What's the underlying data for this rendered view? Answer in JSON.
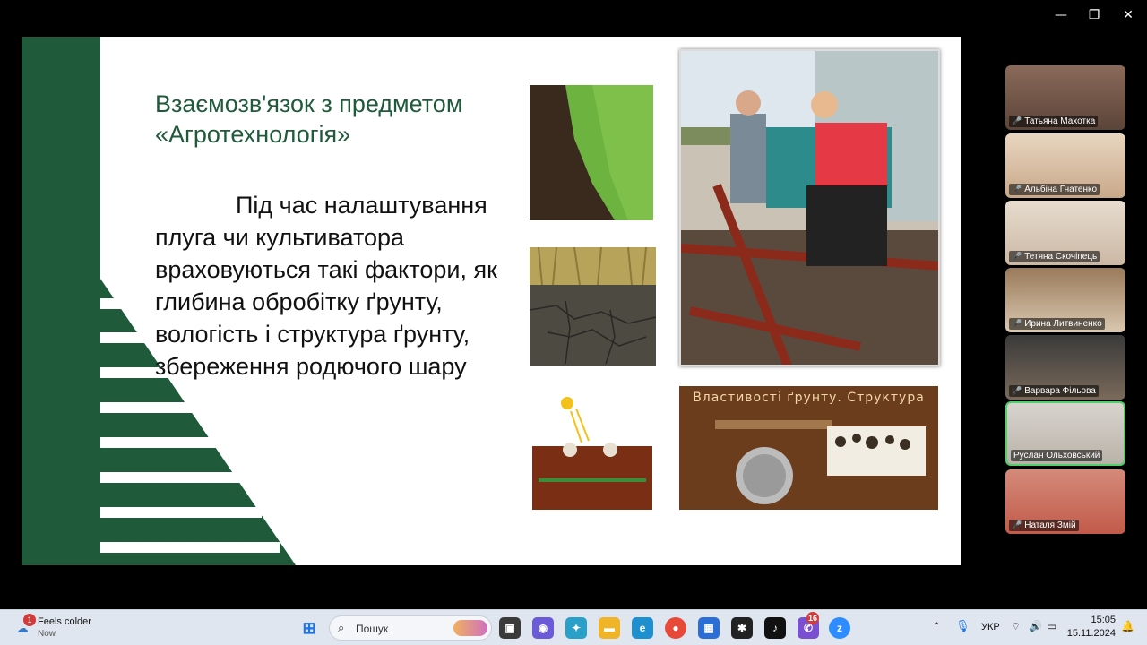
{
  "window": {
    "minimize": "—",
    "restore": "❐",
    "close": "✕"
  },
  "slide": {
    "title": "Взаємозв'язок з предметом «Агротехнологія»",
    "body": "Під час налаштування плуга чи культиватора враховуються такі фактори, як глибина обробітку ґрунту, вологість і структура ґрунту, збереження родючого шару",
    "props_title": "Властивості ґрунту. Структура",
    "colors": {
      "accent_green": "#1f5a3a",
      "slide_bg": "#ffffff"
    }
  },
  "participants": [
    {
      "name": "Татьяна Махотка",
      "muted": true
    },
    {
      "name": "Альбіна Гнатенко",
      "muted": true
    },
    {
      "name": "Тетяна Скочіпець",
      "muted": true
    },
    {
      "name": "Ирина Литвиненко",
      "muted": true
    },
    {
      "name": "Варвара Фільова",
      "muted": true
    },
    {
      "name": "Руслан Ольховський",
      "muted": false,
      "active": true
    },
    {
      "name": "Наталя Змій",
      "muted": true
    }
  ],
  "taskbar": {
    "weather_title": "Feels colder",
    "weather_sub": "Now",
    "weather_badge": "1",
    "search_placeholder": "Пошук",
    "viber_badge": "16",
    "language": "УКР",
    "time": "15:05",
    "date": "15.11.2024"
  }
}
